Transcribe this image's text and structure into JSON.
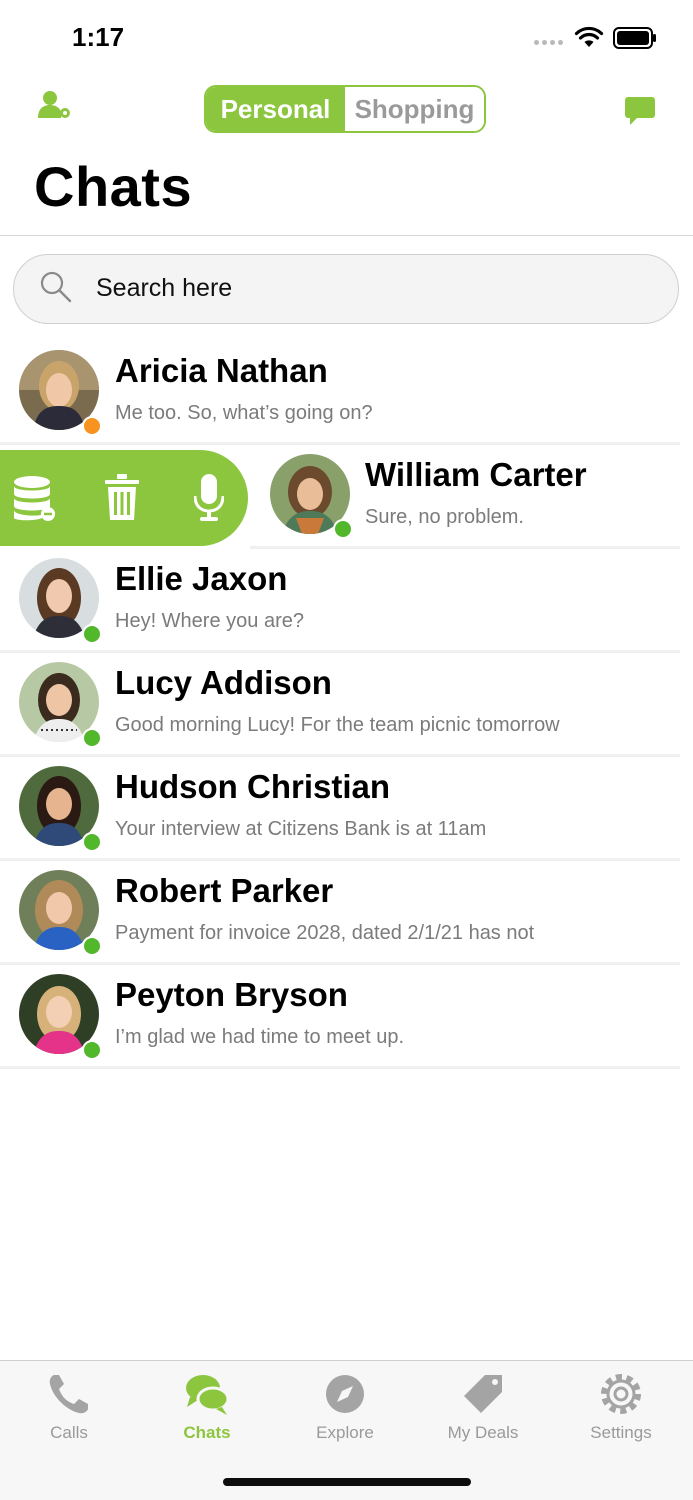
{
  "status_bar": {
    "time": "1:17"
  },
  "header": {
    "segments": [
      "Personal",
      "Shopping"
    ],
    "active_segment": "Personal",
    "title": "Chats"
  },
  "search": {
    "placeholder": "Search here"
  },
  "chats": [
    {
      "name": "Aricia Nathan",
      "message": "Me too. So, what’s going on?",
      "status": "away"
    },
    {
      "name": "William Carter",
      "message": "Sure, no problem.",
      "status": "online"
    },
    {
      "name": "Ellie Jaxon",
      "message": "Hey! Where you are?",
      "status": "online"
    },
    {
      "name": "Lucy Addison",
      "message": "Good morning Lucy! For the team picnic tomorrow",
      "status": "online"
    },
    {
      "name": "Hudson Christian",
      "message": "Your interview at Citizens Bank is at 11am",
      "status": "online"
    },
    {
      "name": "Robert Parker",
      "message": "Payment for invoice 2028, dated 2/1/21 has not",
      "status": "online"
    },
    {
      "name": "Peyton Bryson",
      "message": "I’m glad we had time to meet up.",
      "status": "online"
    }
  ],
  "swipe_actions": [
    "archive-icon",
    "trash-icon",
    "microphone-icon"
  ],
  "tabs": [
    {
      "label": "Calls",
      "icon": "phone-icon"
    },
    {
      "label": "Chats",
      "icon": "chat-bubbles-icon",
      "active": true
    },
    {
      "label": "Explore",
      "icon": "compass-icon"
    },
    {
      "label": "My Deals",
      "icon": "tag-icon"
    },
    {
      "label": "Settings",
      "icon": "gear-icon"
    }
  ],
  "colors": {
    "accent": "#8cc63f",
    "online": "#52b72b",
    "away": "#f7931e",
    "inactive": "#9a9a9a"
  }
}
